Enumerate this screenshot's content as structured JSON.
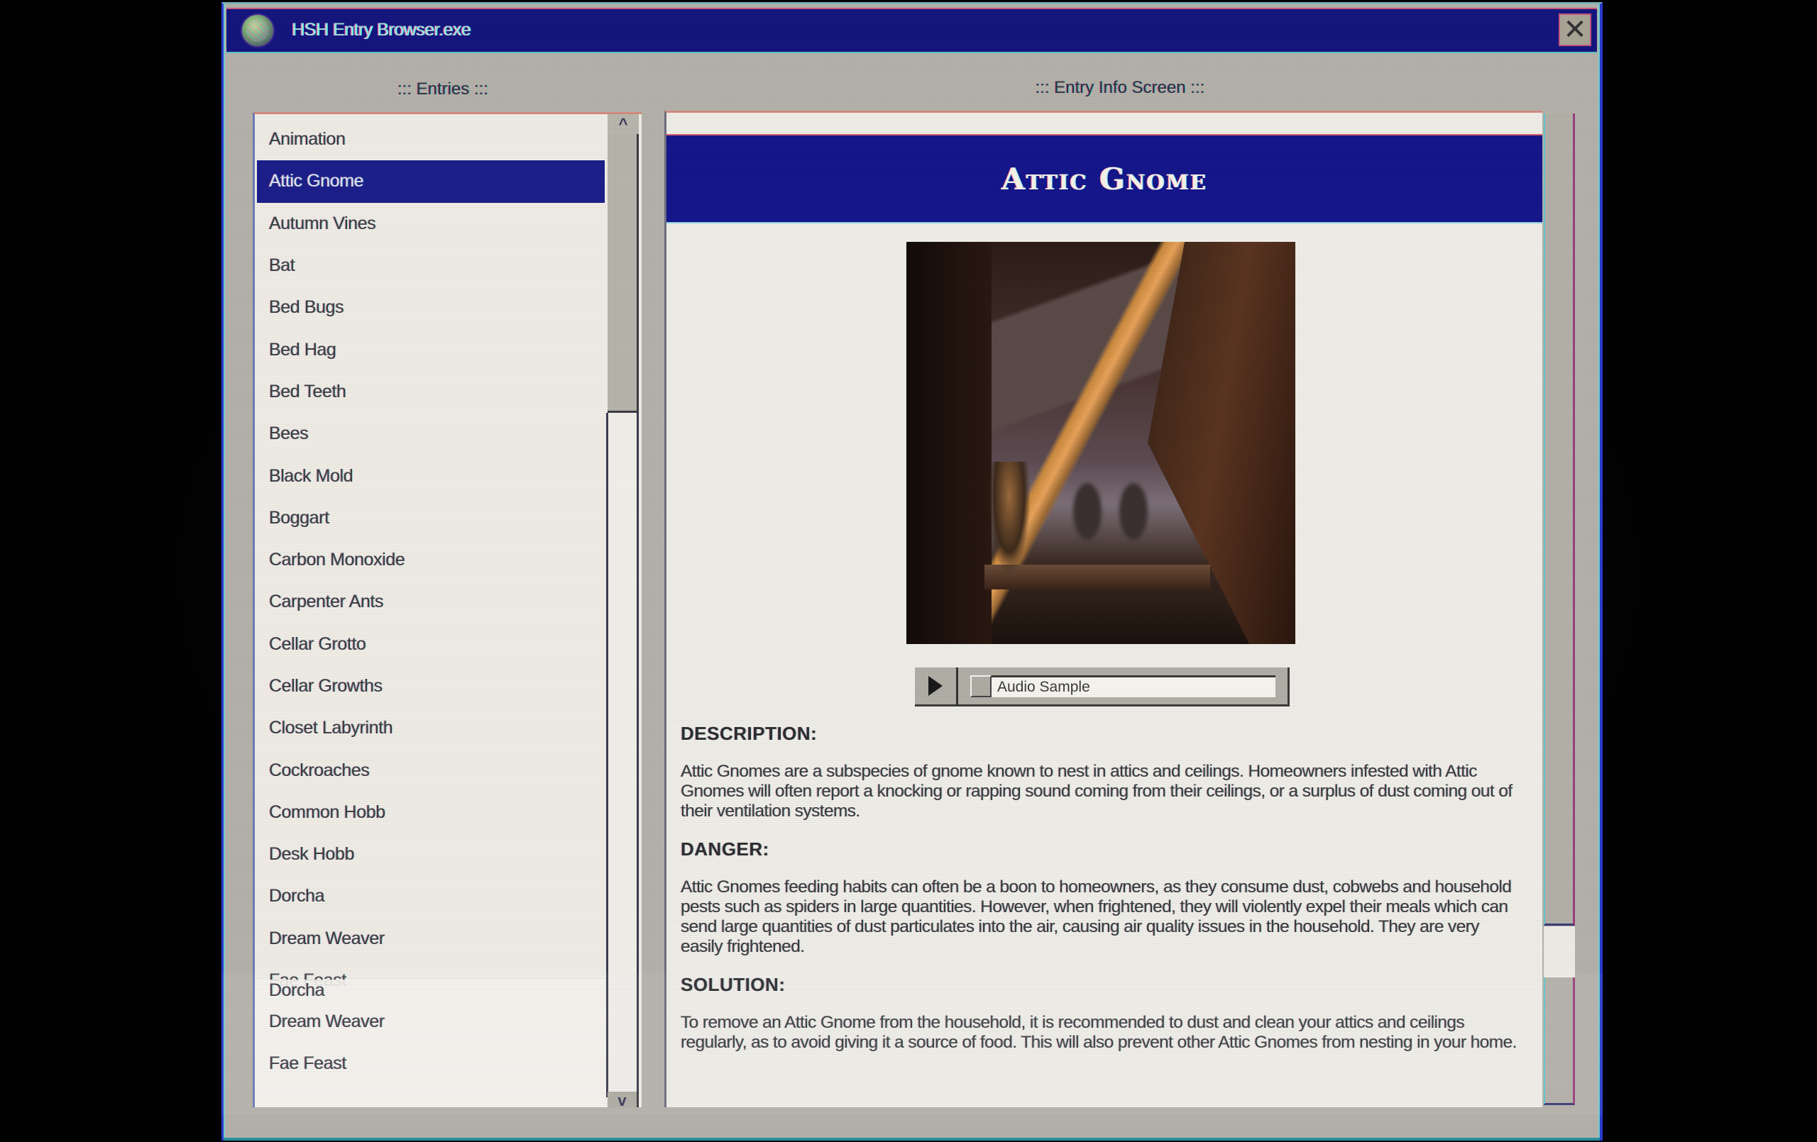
{
  "window": {
    "title": "HSH Entry Browser.exe",
    "app_icon": "globe-icon",
    "close_icon": "close-x-icon",
    "close_glyph": "✕"
  },
  "entries_panel": {
    "label": "::: Entries :::",
    "selected": "Attic Gnome",
    "items": [
      "Animation",
      "Attic Gnome",
      "Autumn Vines",
      "Bat",
      "Bed Bugs",
      "Bed Hag",
      "Bed Teeth",
      "Bees",
      "Black Mold",
      "Boggart",
      "Carbon Monoxide",
      "Carpenter Ants",
      "Cellar Grotto",
      "Cellar Growths",
      "Closet Labyrinth",
      "Cockroaches",
      "Common Hobb",
      "Desk Hobb",
      "Dorcha",
      "Dream Weaver",
      "Fae Feast"
    ],
    "ghost_items": [
      "Dorcha",
      "Dream Weaver",
      "Fae Feast"
    ],
    "scroll_up_glyph": "^",
    "scroll_down_glyph": "v"
  },
  "info_panel": {
    "label": "::: Entry Info Screen :::",
    "title": "Attic Gnome",
    "image_alt": "Attic window with curtain and a small gnome silhouette on the sill",
    "audio": {
      "play_icon": "play-icon",
      "label": "Audio Sample"
    },
    "sections": [
      {
        "heading": "DESCRIPTION:",
        "text": "Attic Gnomes are a subspecies of gnome known to nest in attics and ceilings. Homeowners infested with Attic Gnomes will often report a knocking or rapping sound coming from their ceilings, or a surplus of dust coming out of their ventilation systems."
      },
      {
        "heading": "DANGER:",
        "text": "Attic Gnomes feeding habits can often be a boon to homeowners, as they consume dust, cobwebs and household pests such as spiders in large quantities. However, when frightened, they will violently expel their meals which can send large quantities of dust particulates into the air, causing air quality issues in the household. They are very easily frightened."
      },
      {
        "heading": "SOLUTION:",
        "text": "To remove an Attic Gnome from the household, it is recommended to dust and clean your attics and ceilings regularly, as to avoid giving it a source of food. This will also prevent other Attic Gnomes from nesting in your home."
      }
    ]
  },
  "colors": {
    "titlebar": "#15167e",
    "selection": "#1c1f8a",
    "window_bg": "#b4b1aa",
    "panel_bg": "#efece6"
  }
}
